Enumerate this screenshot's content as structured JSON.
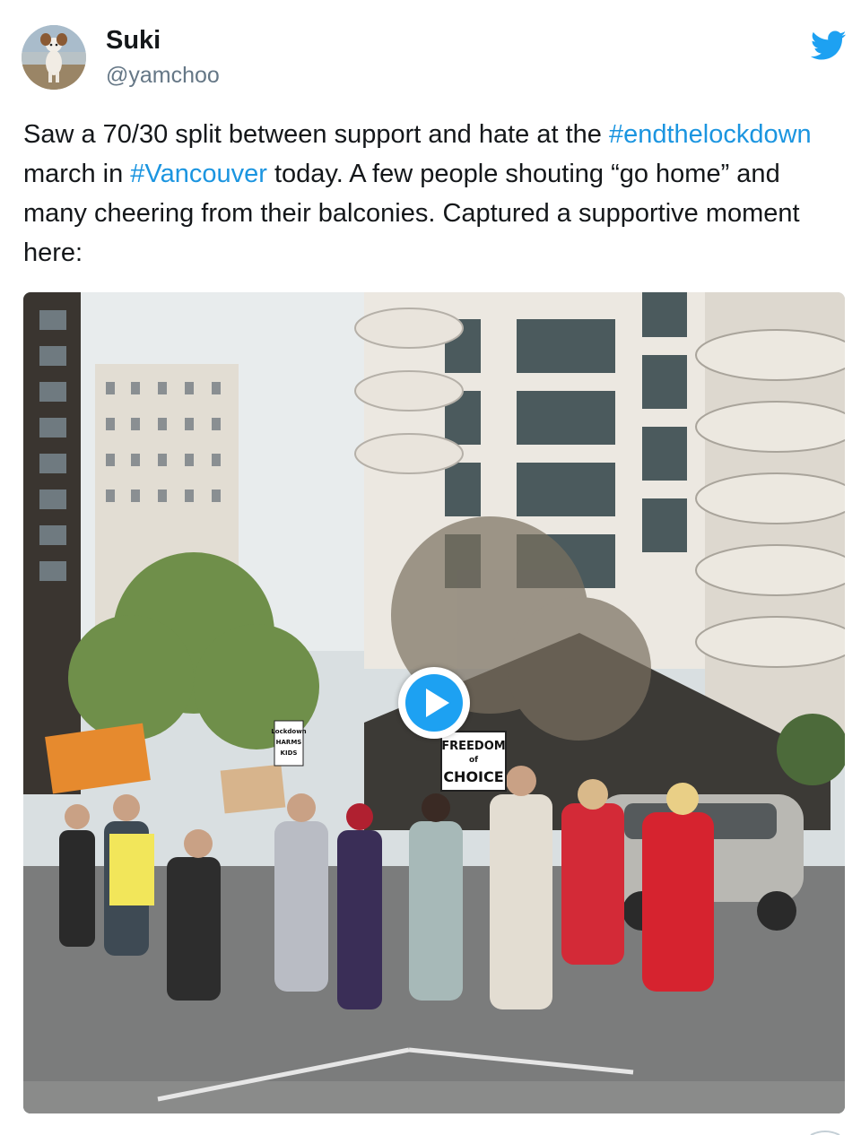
{
  "tweet": {
    "author": {
      "display_name": "Suki",
      "handle": "@yamchoo",
      "avatar_icon": "dog-avatar"
    },
    "brand_icon": "twitter-bird-icon",
    "text": {
      "part1": "Saw a 70/30 split between support and hate at the ",
      "hashtag1": "#endthelockdown",
      "part2": " march in ",
      "hashtag2": "#Vancouver",
      "part3": " today. A few people shouting “go home” and many cheering from their balconies. Captured a supportive moment here:"
    },
    "media": {
      "type": "video",
      "play_icon": "play-icon",
      "signs": {
        "freedom_line1": "FREEDOM",
        "freedom_line2": "of",
        "freedom_line3": "CHOICE",
        "lockdown_line1": "Lockdown",
        "lockdown_line2": "HARMS",
        "lockdown_line3": "KIDS"
      }
    }
  },
  "colors": {
    "link": "#1b95e0",
    "twitter_blue": "#1da1f2",
    "text": "#14171a",
    "secondary_text": "#657786"
  }
}
